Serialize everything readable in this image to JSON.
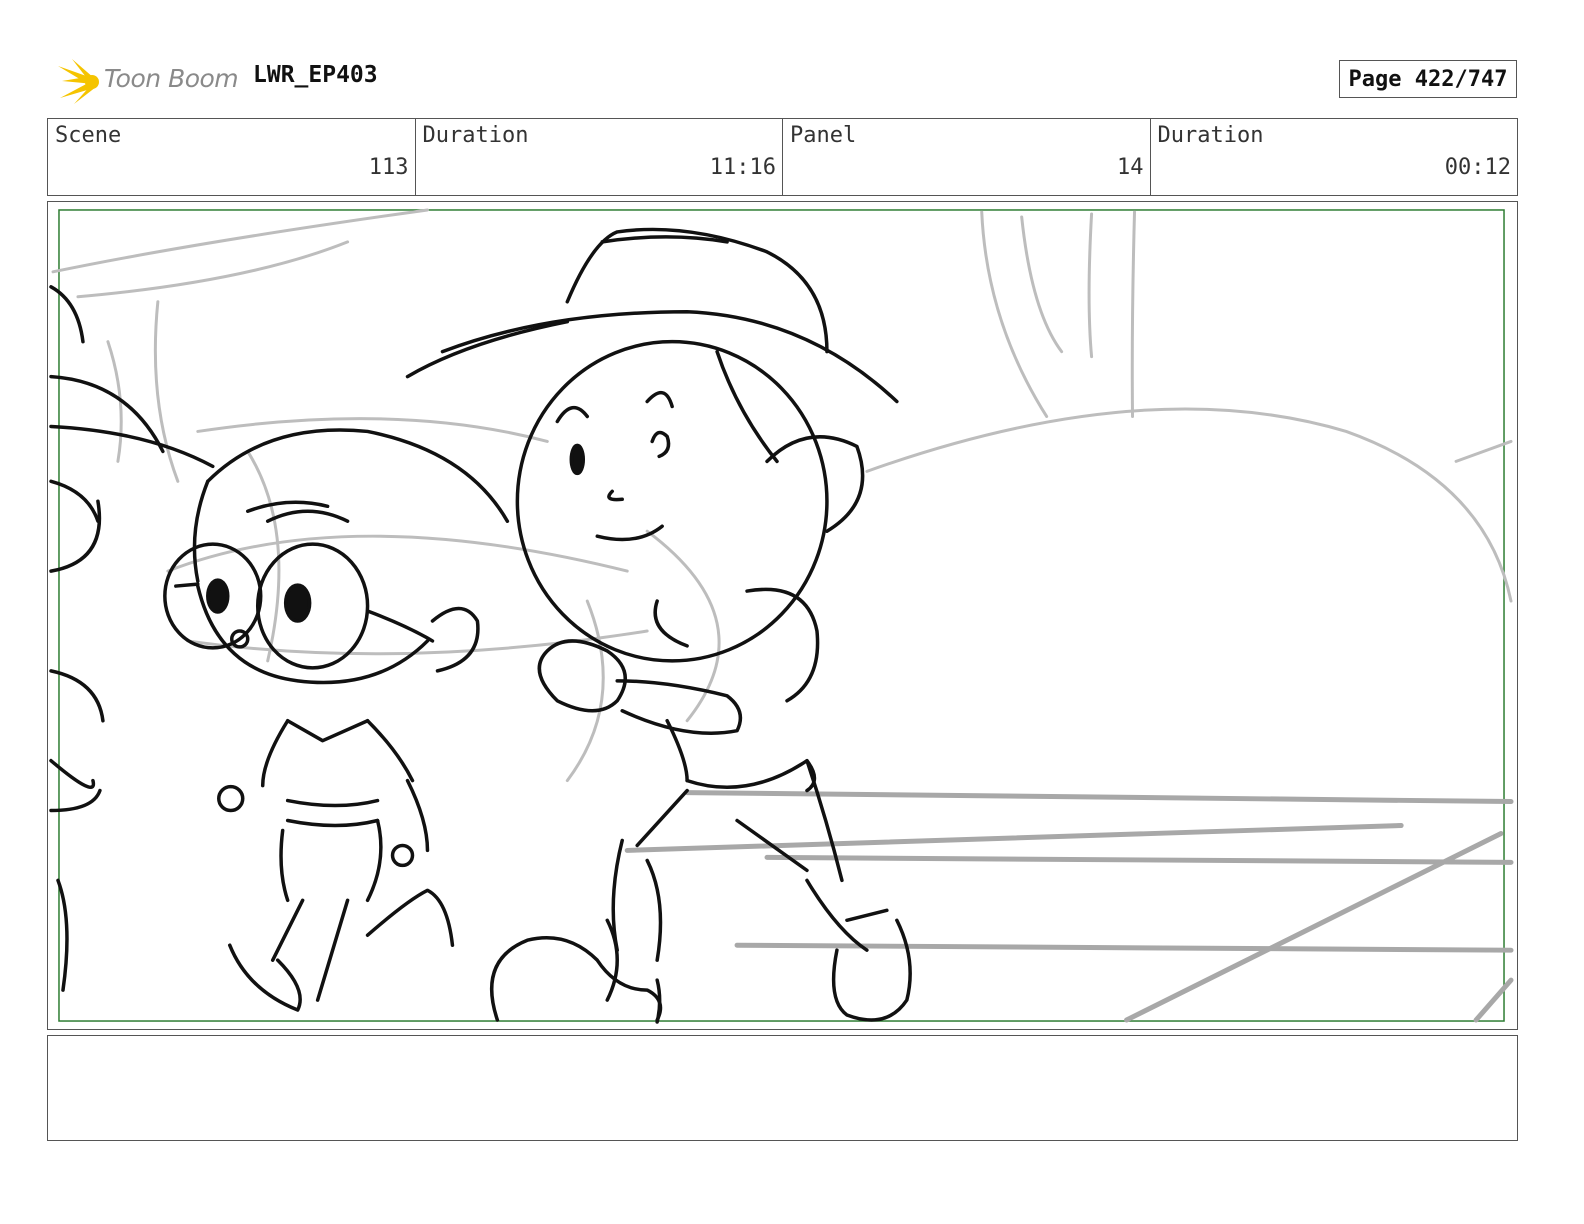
{
  "header": {
    "brand": "Toon Boom",
    "project": "LWR_EP403",
    "page": "Page 422/747"
  },
  "info": {
    "scene_label": "Scene",
    "scene_value": "113",
    "scene_duration_label": "Duration",
    "scene_duration_value": "11:16",
    "panel_label": "Panel",
    "panel_value": "14",
    "panel_duration_label": "Duration",
    "panel_duration_value": "00:12"
  },
  "notes": {
    "text": ""
  },
  "colors": {
    "logo_accent": "#f5c400",
    "safe_frame": "#2e7d32",
    "sketch_line": "#111111",
    "rough_line": "#bdbdbd"
  }
}
